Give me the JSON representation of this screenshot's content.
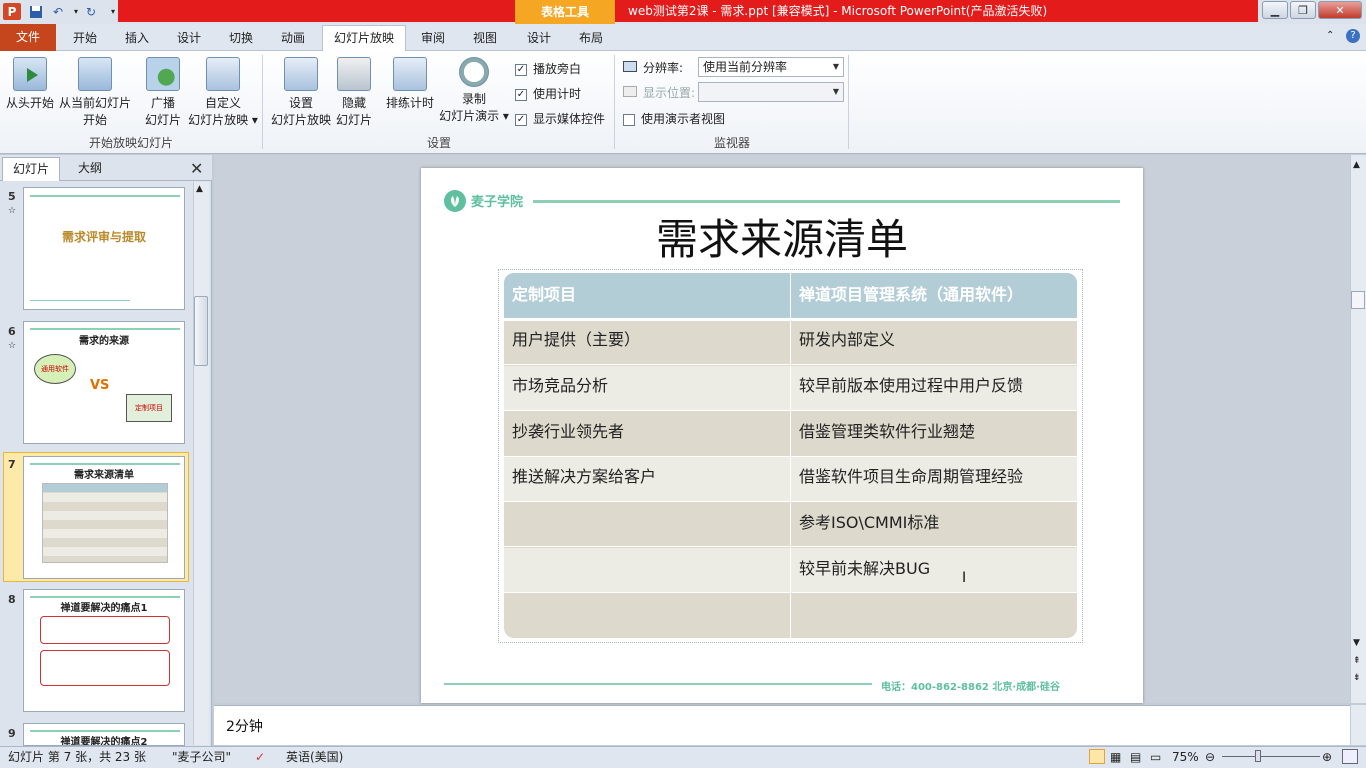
{
  "window": {
    "title": "web测试第2课 - 需求.ppt [兼容模式] - Microsoft PowerPoint(产品激活失败)",
    "context_tab_group": "表格工具"
  },
  "tabs": [
    "开始",
    "插入",
    "设计",
    "切换",
    "动画",
    "幻灯片放映",
    "审阅",
    "视图",
    "设计",
    "布局"
  ],
  "file_tab": "文件",
  "ribbon": {
    "groups": {
      "start_show": "开始放映幻灯片",
      "setup": "设置",
      "monitors": "监视器"
    },
    "from_beginning": "从头开始",
    "from_current_1": "从当前幻灯片",
    "from_current_2": "开始",
    "broadcast_1": "广播",
    "broadcast_2": "幻灯片",
    "custom_1": "自定义",
    "custom_2": "幻灯片放映 ▾",
    "setup_show_1": "设置",
    "setup_show_2": "幻灯片放映",
    "hide_1": "隐藏",
    "hide_2": "幻灯片",
    "rehearse": "排练计时",
    "record_1": "录制",
    "record_2": "幻灯片演示 ▾",
    "play_narration": "播放旁白",
    "use_timings": "使用计时",
    "show_media": "显示媒体控件",
    "resolution_label": "分辨率:",
    "resolution_value": "使用当前分辨率",
    "display_on_label": "显示位置:",
    "presenter_view": "使用演示者视图"
  },
  "left_panel": {
    "tab_slides": "幻灯片",
    "tab_outline": "大纲",
    "thumbnails": [
      {
        "num": "5",
        "title": "需求评审与提取"
      },
      {
        "num": "6",
        "title": "需求的来源",
        "left_bubble": "通用软件",
        "vs": "VS",
        "right_box": "定制项目"
      },
      {
        "num": "7",
        "title": "需求来源清单"
      },
      {
        "num": "8",
        "title": "禅道要解决的痛点1"
      },
      {
        "num": "9",
        "title": "禅道要解决的痛点2"
      }
    ]
  },
  "slide": {
    "logo_text": "麦子学院",
    "title": "需求来源清单",
    "table": {
      "headers": [
        "定制项目",
        "禅道项目管理系统（通用软件）"
      ],
      "rows": [
        [
          "用户提供（主要）",
          "研发内部定义"
        ],
        [
          "市场竞品分析",
          "较早前版本使用过程中用户反馈"
        ],
        [
          "抄袭行业领先者",
          "借鉴管理类软件行业翘楚"
        ],
        [
          "推送解决方案给客户",
          "借鉴软件项目生命周期管理经验"
        ],
        [
          "",
          "参考ISO\\CMMI标准"
        ],
        [
          "",
          "较早前未解决BUG"
        ],
        [
          "",
          ""
        ]
      ]
    },
    "footer": "电话：400-862-8862    北京·成都·硅谷"
  },
  "notes_text": "2分钟",
  "status": {
    "slide_info": "幻灯片 第 7 张，共 23 张",
    "theme": "\"麦子公司\"",
    "language": "英语(美国)",
    "zoom": "75%"
  },
  "colors": {
    "title_red": "#e31b1b",
    "file_tab": "#c5461c",
    "table_header": "#b3cdd6",
    "row_dark": "#ddd9cd",
    "row_light": "#ecebe4",
    "accent_green": "#5fbf9f"
  }
}
